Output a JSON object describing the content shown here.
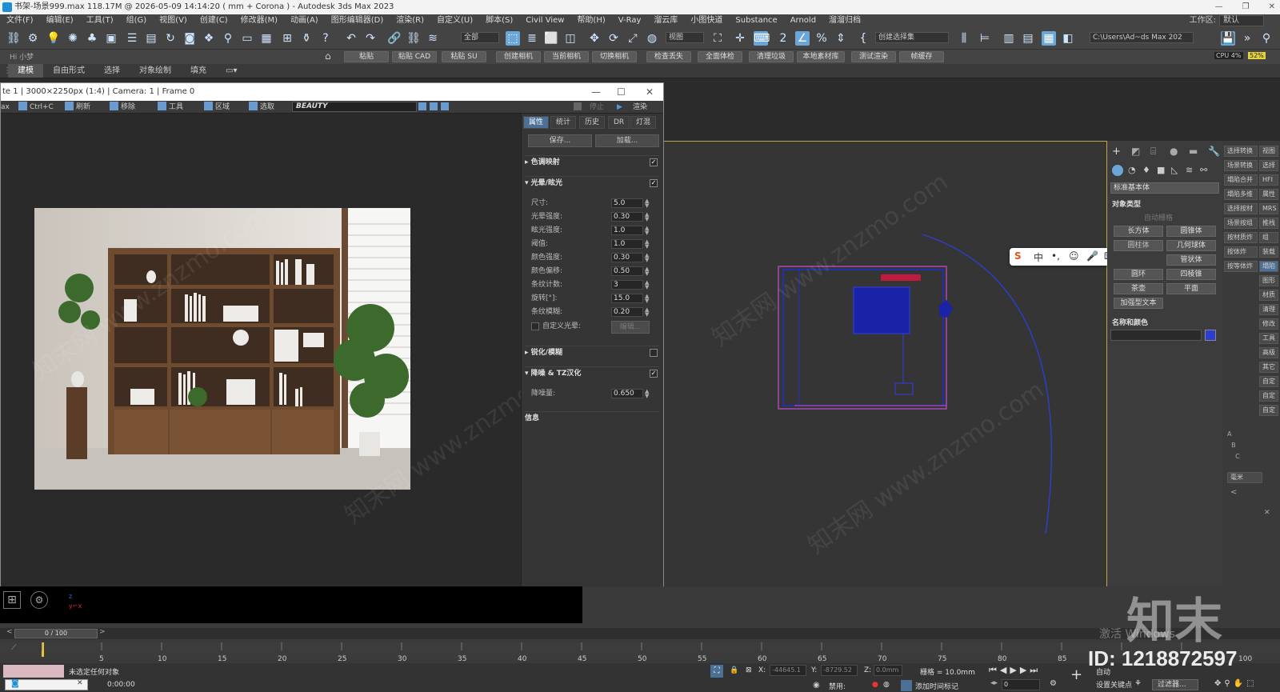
{
  "titlebar": {
    "title": "书架-场景999.max  118.17M @ 2026-05-09 14:14:20  ( mm + Corona ) - Autodesk 3ds Max 2023"
  },
  "menu": [
    "文件(F)",
    "编辑(E)",
    "工具(T)",
    "组(G)",
    "视图(V)",
    "创建(C)",
    "修改器(M)",
    "动画(A)",
    "图形编辑器(D)",
    "渲染(R)",
    "自定义(U)",
    "脚本(S)",
    "Civil View",
    "帮助(H)",
    "V-Ray",
    "溜云库",
    "小图快道",
    "Substance",
    "Arnold",
    "溜溜归档"
  ],
  "workspace": {
    "label": "工作区:",
    "value": "默认"
  },
  "toolbar1": {
    "filter_drop": "全部",
    "view_drop": "视图",
    "selset_drop": "创建选择集",
    "path": "C:\\Users\\Ad~ds Max 202",
    "cpu": "CPU 4%",
    "mem": "52%"
  },
  "toolbar2": {
    "user": "Hi 小梦",
    "buttons": [
      "粘贴",
      "粘贴 CAD",
      "粘贴 SU",
      "创建相机",
      "当前相机",
      "切换相机",
      "检查丢失",
      "全面体检",
      "清理垃圾",
      "本地素材库",
      "测试渲染",
      "帧缓存"
    ]
  },
  "ribbon": {
    "tabs": [
      "建模",
      "自由形式",
      "选择",
      "对象绘制",
      "填充"
    ]
  },
  "render_window": {
    "title": "te 1 | 3000×2250px (1:4) | Camera: 1 | Frame 0",
    "tools": [
      "ax",
      "Ctrl+C",
      "刷新",
      "移除",
      "工具",
      "区域",
      "选取"
    ],
    "channel": "BEAUTY",
    "stop": "停止",
    "render": "渲染",
    "tabs": [
      "属性",
      "统计",
      "历史",
      "DR",
      "灯混"
    ],
    "save_btn": "保存...",
    "load_btn": "加载...",
    "sections": {
      "tonemap": "色调映射",
      "bloom": "光晕/眩光",
      "sharpen": "锐化/模糊",
      "denoise": "降噪 & TZ汉化",
      "info": "信息"
    },
    "bloom_params": [
      {
        "label": "尺寸:",
        "value": "5.0"
      },
      {
        "label": "光晕强度:",
        "value": "0.30"
      },
      {
        "label": "眩光强度:",
        "value": "1.0"
      },
      {
        "label": "阈值:",
        "value": "1.0"
      },
      {
        "label": "颜色强度:",
        "value": "0.30"
      },
      {
        "label": "颜色偏移:",
        "value": "0.50"
      },
      {
        "label": "条纹计数:",
        "value": "3"
      },
      {
        "label": "旋转[°]:",
        "value": "15.0"
      },
      {
        "label": "条纹模糊:",
        "value": "0.20"
      }
    ],
    "custom_bloom": "自定义光晕:",
    "edit_btn": "编辑...",
    "denoise_label": "降噪量:",
    "denoise_value": "0.650"
  },
  "command_panel": {
    "dropdown": "标准基本体",
    "rollout_object_type": "对象类型",
    "autogrid": "自动栅格",
    "buttons": [
      "长方体",
      "圆锥体",
      "几何球体",
      "管状体",
      "圆环",
      "四棱锥",
      "茶壶",
      "平面",
      "加强型文本"
    ],
    "hidden_left": "圆柱体",
    "rollout_name_color": "名称和颜色"
  },
  "right_strip": [
    "选择转换",
    "视图",
    "场景转换",
    "选择",
    "塌陷合并",
    "HFI",
    "塌陷多维",
    "属性",
    "选择按材",
    "MRS",
    "场景按组",
    "推栈",
    "按材质炸",
    "组",
    "按体炸",
    "装载",
    "按等体炸",
    "塌陷",
    "图形",
    "材质",
    "清理",
    "修改",
    "工具",
    "高级",
    "其它",
    "自定",
    "自定",
    "自定"
  ],
  "units": "毫米",
  "timeline": {
    "frame": "0 / 100",
    "ticks": [
      "5",
      "10",
      "15",
      "20",
      "25",
      "30",
      "35",
      "40",
      "45",
      "50",
      "55",
      "60",
      "65",
      "70",
      "75",
      "80",
      "85",
      "100"
    ]
  },
  "status": {
    "selection": "未选定任何对象",
    "time": "0:00:00",
    "x_label": "X:",
    "x_value": "-44645.1",
    "y_label": "Y:",
    "y_value": "-8729.52",
    "z_label": "Z:",
    "z_value": "0.0mm",
    "grid": "栅格 = 10.0mm",
    "enable": "禁用:",
    "add_tag": "添加时间标记",
    "auto": "自动",
    "set_key": "设置关键点",
    "filter": "过滤器...",
    "frame_field": "0"
  },
  "overlay": {
    "activate": "激活 Windows",
    "logo": "知末",
    "id": "ID: 1218872597"
  },
  "watermark": "知末网 www.znzmo.com"
}
